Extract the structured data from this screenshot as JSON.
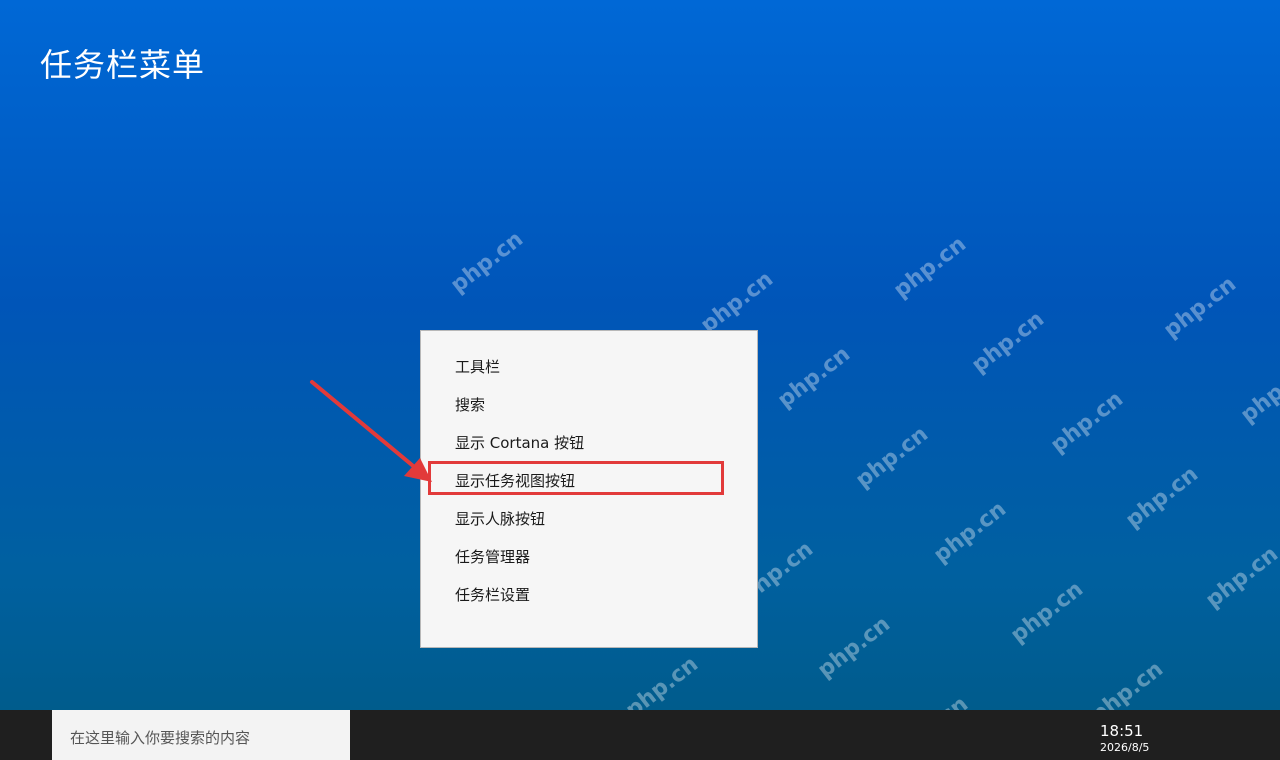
{
  "page": {
    "title": "任务栏菜单"
  },
  "watermark_text": "php.cn",
  "context_menu": {
    "items": [
      {
        "label": "工具栏"
      },
      {
        "label": "搜索"
      },
      {
        "label": "显示 Cortana 按钮"
      },
      {
        "label": "显示任务视图按钮"
      },
      {
        "label": "显示人脉按钮"
      },
      {
        "label": "任务管理器"
      },
      {
        "label": "任务栏设置"
      }
    ],
    "highlighted_index": 3
  },
  "taskbar": {
    "search_placeholder": "在这里输入你要搜索的内容",
    "time": "18:51",
    "date": "2026/8/5"
  },
  "colors": {
    "highlight": "#e23a3a",
    "taskbar": "#1f1f1f",
    "menu_bg": "#f6f6f6"
  }
}
